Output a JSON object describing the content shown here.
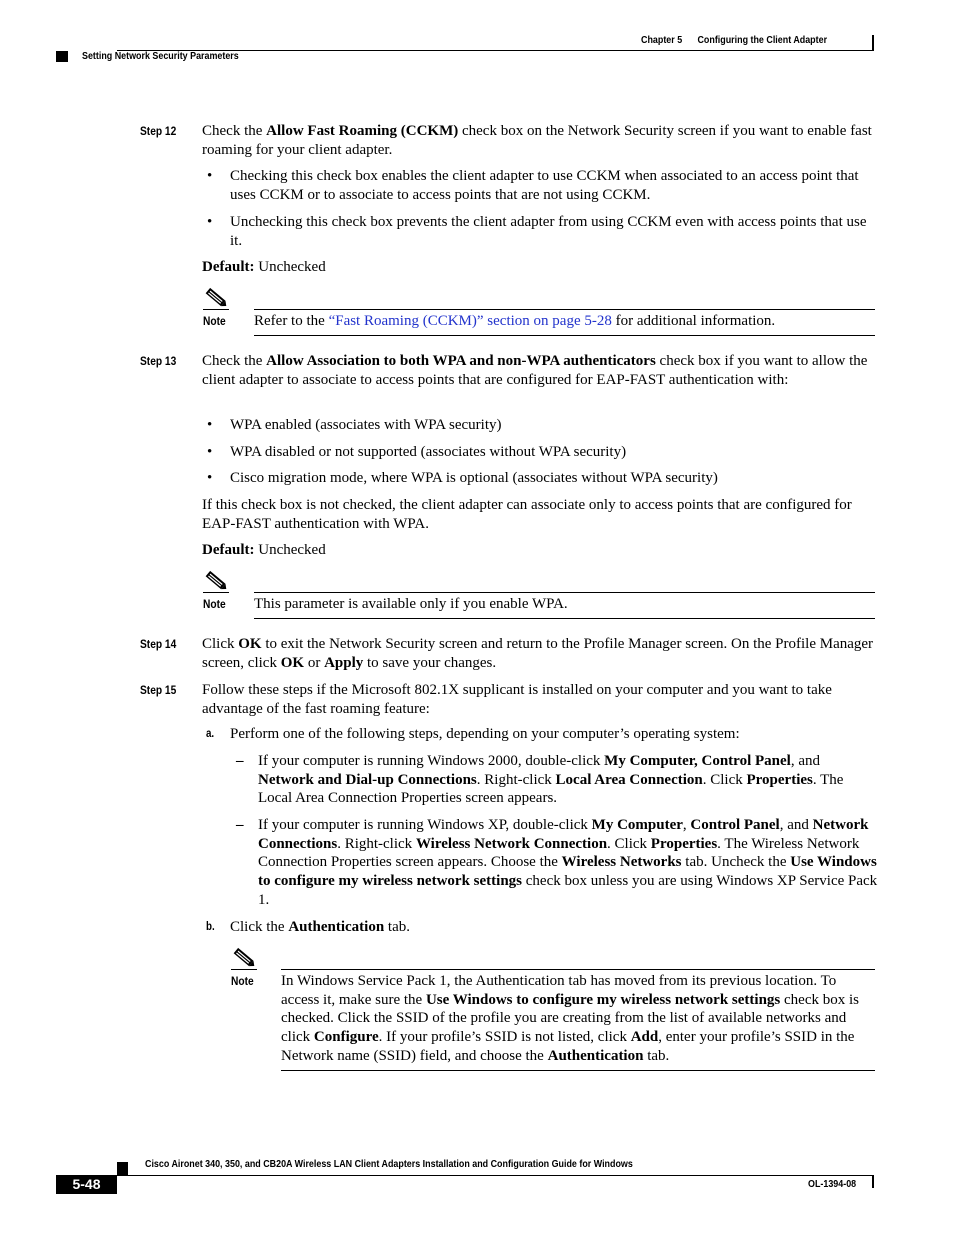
{
  "header": {
    "chapter_label": "Chapter 5",
    "chapter_title": "Configuring the Client Adapter",
    "section_title": "Setting Network Security Parameters"
  },
  "steps": [
    {
      "label": "Step 12",
      "intro": {
        "pre": "Check the ",
        "bold": "Allow Fast Roaming",
        "bold2": "(CCKM)",
        "post": " check box on the Network Security screen if you want to enable fast roaming for your client adapter."
      },
      "bullets": [
        "Checking this check box enables the client adapter to use CCKM when associated to an access point that uses CCKM or to associate to access points that are not using CCKM.",
        "Unchecking this check box prevents the client adapter from using CCKM even with access points that use it."
      ],
      "default_label": "Default:",
      "default_value": "Unchecked",
      "note": {
        "label": "Note",
        "pre": "Refer to the ",
        "link": "“Fast Roaming (CCKM)” section on page 5-28",
        "post": " for additional information."
      }
    },
    {
      "label": "Step 13",
      "intro": {
        "pre": "Check the ",
        "bold": "Allow Association to both WPA and non-WPA authenticators",
        "post": " check box if you want to allow the client adapter to associate to access points that are configured for EAP-FAST authentication with:"
      },
      "bullets": [
        "WPA enabled (associates with WPA security)",
        "WPA disabled or not supported (associates without WPA security)",
        "Cisco migration mode, where WPA is optional (associates without WPA security)"
      ],
      "extra": "If this check box is not checked, the client adapter can associate only to access points that are configured for EAP-FAST authentication with WPA.",
      "default_label": "Default:",
      "default_value": "Unchecked",
      "note": {
        "label": "Note",
        "text": "This parameter is available only if you enable WPA."
      }
    },
    {
      "label": "Step 14",
      "parts": {
        "p1": "Click ",
        "b1": "OK",
        "p2": " to exit the Network Security screen and return to the Profile Manager screen. On the Profile Manager screen, click ",
        "b2": "OK",
        "p3": " or ",
        "b3": "Apply",
        "p4": " to save your changes."
      }
    },
    {
      "label": "Step 15",
      "intro": "Follow these steps if the Microsoft 802.1X supplicant is installed on your computer and you want to take advantage of the fast roaming feature:",
      "substeps": [
        {
          "label": "a.",
          "text": "Perform one of the following steps, depending on your computer’s operating system:",
          "dashes": [
            {
              "p1": "If your computer is running Windows 2000, double-click ",
              "b1": "My Computer, Control Panel",
              "p2": ", and ",
              "b2": "Network and Dial-up Connections",
              "p3": ". Right-click ",
              "b3": "Local Area Connection",
              "p4": ". Click ",
              "b4": "Properties",
              "p5": ". The Local Area Connection Properties screen appears."
            },
            {
              "p1": "If your computer is running Windows XP, double-click ",
              "b1": "My Computer",
              "p2": ", ",
              "b2": "Control Panel",
              "p3": ", and ",
              "b3": "Network Connections",
              "p4": ". Right-click ",
              "b4": "Wireless Network Connection",
              "p5": ". Click ",
              "b5": "Properties",
              "p6": ". The Wireless Network Connection Properties screen appears. Choose the ",
              "b6": "Wireless Networks",
              "p7": " tab. Uncheck the ",
              "b7": "Use Windows to configure my wireless network settings",
              "p8": " check box unless you are using Windows XP Service Pack 1."
            }
          ]
        },
        {
          "label": "b.",
          "p1": "Click the ",
          "b1": "Authentication",
          "p2": " tab."
        }
      ],
      "note": {
        "label": "Note",
        "p1": "In Windows Service Pack 1, the Authentication tab has moved from its previous location. To access it, make sure the ",
        "b1": "Use Windows to configure my wireless network settings",
        "p2": " check box is checked. Click the SSID of the profile you are creating from the list of available networks and click ",
        "b2": "Configure",
        "p3": ". If your profile’s SSID is not listed, click ",
        "b3": "Add",
        "p4": ", enter your profile’s SSID in the Network name (SSID) field, and choose the ",
        "b4": "Authentication",
        "p5": " tab."
      }
    }
  ],
  "footer": {
    "guide_title": "Cisco Aironet 340, 350, and CB20A Wireless LAN Client Adapters Installation and Configuration Guide for Windows",
    "page_number": "5-48",
    "doc_number": "OL-1394-08"
  },
  "colors": {
    "link": "#2233cc",
    "text": "#000000"
  },
  "icons": {
    "note": "pencil-note-icon"
  }
}
